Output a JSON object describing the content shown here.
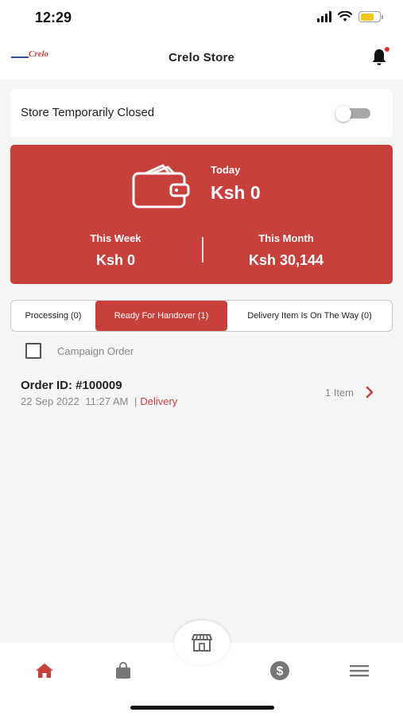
{
  "status_bar": {
    "time": "12:29"
  },
  "header": {
    "logo_text": "Crelo",
    "title": "Crelo Store",
    "notification_dot_color": "#d9312b"
  },
  "store_status": {
    "label": "Store Temporarily Closed",
    "toggle_on": false
  },
  "earnings": {
    "today_label": "Today",
    "today_value": "Ksh 0",
    "week_label": "This Week",
    "week_value": "Ksh 0",
    "month_label": "This Month",
    "month_value": "Ksh 30,144",
    "card_color": "#c8403b"
  },
  "tabs": [
    {
      "label": "Processing (0)",
      "active": false
    },
    {
      "label": "Ready For Handover (1)",
      "active": true
    },
    {
      "label": "Delivery Item Is On The Way (0)",
      "active": false
    }
  ],
  "filter": {
    "campaign_label": "Campaign Order",
    "checked": false
  },
  "orders": [
    {
      "id": "Order ID: #100009",
      "date": "22 Sep 2022",
      "time": "11:27 AM",
      "separator": "|",
      "type": "Delivery",
      "items": "1 Item"
    }
  ],
  "bottom_nav": {
    "items": [
      "home-icon",
      "bag-icon",
      "store-icon",
      "dollar-icon",
      "menu-icon"
    ],
    "active": "home-icon",
    "accent_color": "#c8403b"
  }
}
